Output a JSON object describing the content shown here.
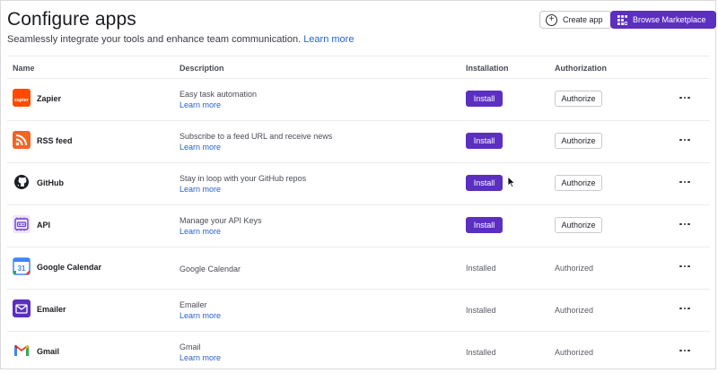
{
  "header": {
    "title": "Configure apps",
    "subtitle": "Seamlessly integrate your tools and enhance team communication.",
    "subtitle_link": "Learn more",
    "create_app_label": "Create app",
    "browse_marketplace_label": "Browse Marketplace"
  },
  "table": {
    "columns": [
      "Name",
      "Description",
      "Installation",
      "Authorization"
    ],
    "rows": [
      {
        "name": "Zapier",
        "icon": "zapier-icon",
        "description": "Easy task automation",
        "learn_more": "Learn more",
        "install_label": "Install",
        "authorize_label": "Authorize"
      },
      {
        "name": "RSS feed",
        "icon": "rss-icon",
        "description": "Subscribe to a feed URL and receive news",
        "learn_more": "Learn more",
        "install_label": "Install",
        "authorize_label": "Authorize"
      },
      {
        "name": "GitHub",
        "icon": "github-icon",
        "description": "Stay in loop with your GitHub repos",
        "learn_more": "Learn more",
        "install_label": "Install",
        "authorize_label": "Authorize"
      },
      {
        "name": "API",
        "icon": "api-icon",
        "description": "Manage your API Keys",
        "learn_more": "Learn more",
        "install_label": "Install",
        "authorize_label": "Authorize"
      },
      {
        "name": "Google Calendar",
        "icon": "google-calendar-icon",
        "description": "Google Calendar",
        "installation_status": "Installed",
        "authorization_status": "Authorized"
      },
      {
        "name": "Emailer",
        "icon": "emailer-icon",
        "description": "Emailer",
        "learn_more": "Learn more",
        "installation_status": "Installed",
        "authorization_status": "Authorized"
      },
      {
        "name": "Gmail",
        "icon": "gmail-icon",
        "description": "Gmail",
        "learn_more": "Learn more",
        "installation_status": "Installed",
        "authorization_status": "Authorized"
      }
    ]
  },
  "colors": {
    "accent": "#5b2fc0",
    "link": "#2b62c9",
    "zapier": "#ff4a00",
    "rss": "#f26522"
  },
  "calendar_icon_text": "31"
}
